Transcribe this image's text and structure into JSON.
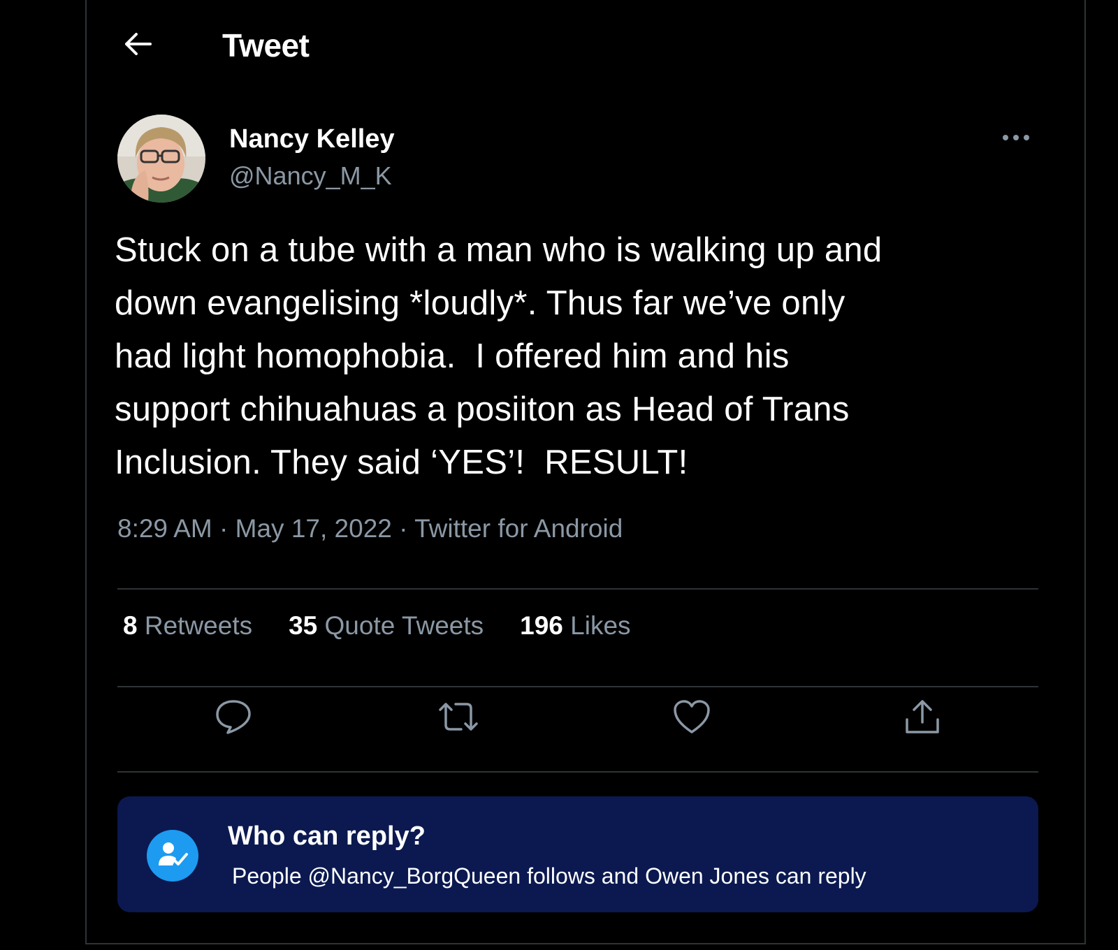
{
  "header": {
    "title": "Tweet",
    "back_icon": "arrow-left-icon"
  },
  "author": {
    "display_name": "Nancy Kelley",
    "handle": "@Nancy_M_K",
    "avatar_icon": "profile-photo"
  },
  "tweet": {
    "text": "Stuck on a tube with a man who is walking up and\ndown evangelising *loudly*. Thus far we’ve only\nhad light homophobia.  I offered him and his\nsupport chihuahuas a posiiton as Head of Trans\nInclusion. They said ‘YES’!  RESULT!",
    "time": "8:29 AM",
    "separator": "·",
    "date": "May 17, 2022",
    "source": "Twitter for Android"
  },
  "stats": {
    "retweets_count": "8",
    "retweets_label": "Retweets",
    "quotes_count": "35",
    "quotes_label": "Quote Tweets",
    "likes_count": "196",
    "likes_label": "Likes"
  },
  "actions": {
    "icons": [
      "reply-icon",
      "retweet-icon",
      "like-icon",
      "share-icon"
    ]
  },
  "reply_settings": {
    "title": "Who can reply?",
    "description": "People @Nancy_BorgQueen follows and Owen Jones can reply",
    "icon": "user-check-icon"
  },
  "colors": {
    "background": "#000000",
    "text_primary": "#ffffff",
    "text_secondary": "#8b98a5",
    "divider": "#2f3336",
    "accent": "#1d9bf0",
    "reply_box_bg": "#0b1950"
  }
}
